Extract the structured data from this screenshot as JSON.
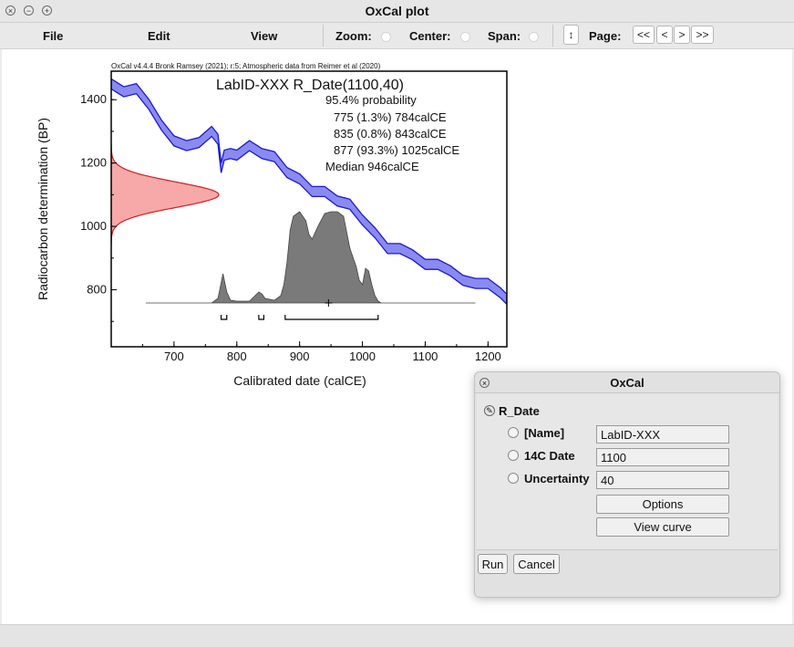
{
  "window": {
    "title": "OxCal plot"
  },
  "menu": {
    "file": "File",
    "edit": "Edit",
    "view": "View",
    "zoom": "Zoom:",
    "center": "Center:",
    "span": "Span:",
    "page": "Page:",
    "resize_symbol": "↕",
    "nav": [
      "<<",
      "<",
      ">",
      ">>"
    ]
  },
  "chart_data": {
    "type": "area",
    "credit": "OxCal v4.4.4 Bronk Ramsey (2021); r:5; Atmospheric data from Reimer et al (2020)",
    "title": "LabID-XXX R_Date(1100,40)",
    "xlabel": "Calibrated date (calCE)",
    "ylabel": "Radiocarbon determination (BP)",
    "xlim": [
      600,
      1230
    ],
    "ylim": [
      620,
      1490
    ],
    "x_ticks": [
      "700",
      "800",
      "900",
      "1000",
      "1100",
      "1200"
    ],
    "y_ticks": [
      "800",
      "1000",
      "1200",
      "1400"
    ],
    "summary": [
      "95.4% probability",
      "775 (1.3%) 784calCE",
      "835 (0.8%) 843calCE",
      "877 (93.3%) 1025calCE",
      "Median 946calCE"
    ],
    "calibration_curve": {
      "color": "#1a1ad6",
      "x": [
        600,
        620,
        640,
        660,
        680,
        700,
        720,
        740,
        760,
        770,
        775,
        780,
        790,
        800,
        820,
        840,
        860,
        880,
        900,
        920,
        940,
        960,
        980,
        1000,
        1020,
        1040,
        1060,
        1080,
        1100,
        1120,
        1140,
        1160,
        1180,
        1200,
        1220,
        1230
      ],
      "y": [
        1450,
        1425,
        1435,
        1385,
        1320,
        1270,
        1255,
        1265,
        1300,
        1275,
        1185,
        1225,
        1230,
        1225,
        1255,
        1230,
        1220,
        1170,
        1150,
        1110,
        1110,
        1080,
        1070,
        1020,
        980,
        930,
        930,
        910,
        880,
        880,
        860,
        830,
        820,
        820,
        790,
        770
      ]
    },
    "measurement": {
      "mean_bp": 1100,
      "sd": 40,
      "color": "#f7a8a8"
    },
    "posterior": {
      "color": "#7a7a7a",
      "x": [
        655,
        760,
        770,
        778,
        784,
        790,
        800,
        820,
        835,
        840,
        845,
        860,
        870,
        875,
        880,
        885,
        890,
        900,
        910,
        915,
        920,
        930,
        940,
        950,
        960,
        970,
        980,
        990,
        995,
        1000,
        1005,
        1010,
        1015,
        1020,
        1025,
        1030,
        1040,
        1180
      ],
      "y": [
        0,
        0,
        0.05,
        0.32,
        0.12,
        0.03,
        0.02,
        0.02,
        0.12,
        0.1,
        0.05,
        0.03,
        0.08,
        0.2,
        0.45,
        0.8,
        0.95,
        1.0,
        0.9,
        0.75,
        0.7,
        0.85,
        0.98,
        1.0,
        1.0,
        0.95,
        0.6,
        0.4,
        0.25,
        0.2,
        0.38,
        0.35,
        0.2,
        0.08,
        0.02,
        0,
        0,
        0
      ]
    },
    "ranges_95": [
      [
        775,
        784
      ],
      [
        835,
        843
      ],
      [
        877,
        1025
      ]
    ],
    "median": 946
  },
  "dialog": {
    "title": "OxCal",
    "section": "R_Date",
    "fields": [
      {
        "label": "[Name]",
        "value": "LabID-XXX"
      },
      {
        "label": "14C Date",
        "value": "1100"
      },
      {
        "label": "Uncertainty",
        "value": "40"
      }
    ],
    "options_label": "Options",
    "view_curve_label": "View curve",
    "run_label": "Run",
    "cancel_label": "Cancel"
  }
}
